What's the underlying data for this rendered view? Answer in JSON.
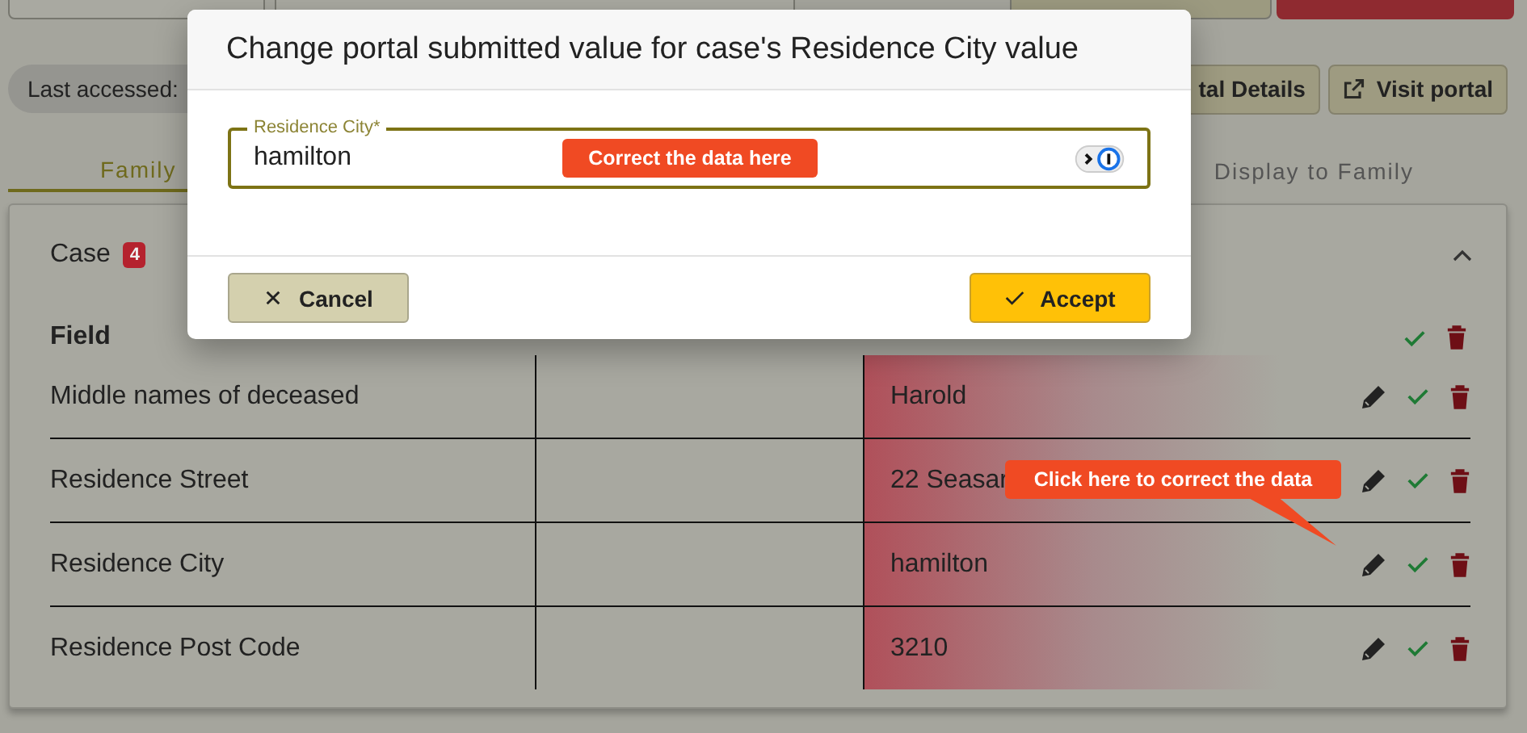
{
  "last_accessed": {
    "label": "Last accessed:"
  },
  "header_buttons": [
    {
      "label": "tal Details",
      "kind": "plain"
    },
    {
      "label": "Visit portal",
      "kind": "external"
    }
  ],
  "tabs": [
    {
      "label": "Family",
      "selected": true
    },
    {
      "label": "Display to Family",
      "selected": false
    }
  ],
  "case": {
    "title": "Case",
    "count": "4",
    "expanded": true
  },
  "table": {
    "columns": [
      "Field"
    ],
    "rows": [
      {
        "field": "Middle names of deceased",
        "value": "Harold",
        "flagged": true
      },
      {
        "field": "Residence Street",
        "value": "22 Seasar",
        "flagged": true
      },
      {
        "field": "Residence City",
        "value": "hamilton",
        "flagged": true
      },
      {
        "field": "Residence Post Code",
        "value": "3210",
        "flagged": true
      }
    ]
  },
  "dialog": {
    "title": "Change portal submitted value for case's Residence City value",
    "field": {
      "label": "Residence City*",
      "value": "hamilton"
    },
    "buttons": [
      {
        "label": "Cancel",
        "kind": "cancel"
      },
      {
        "label": "Accept",
        "kind": "accept"
      }
    ]
  },
  "callouts": [
    {
      "text": "Correct the data here",
      "kind": "plain"
    },
    {
      "text": "Click here to correct the data",
      "kind": "pointer"
    }
  ]
}
